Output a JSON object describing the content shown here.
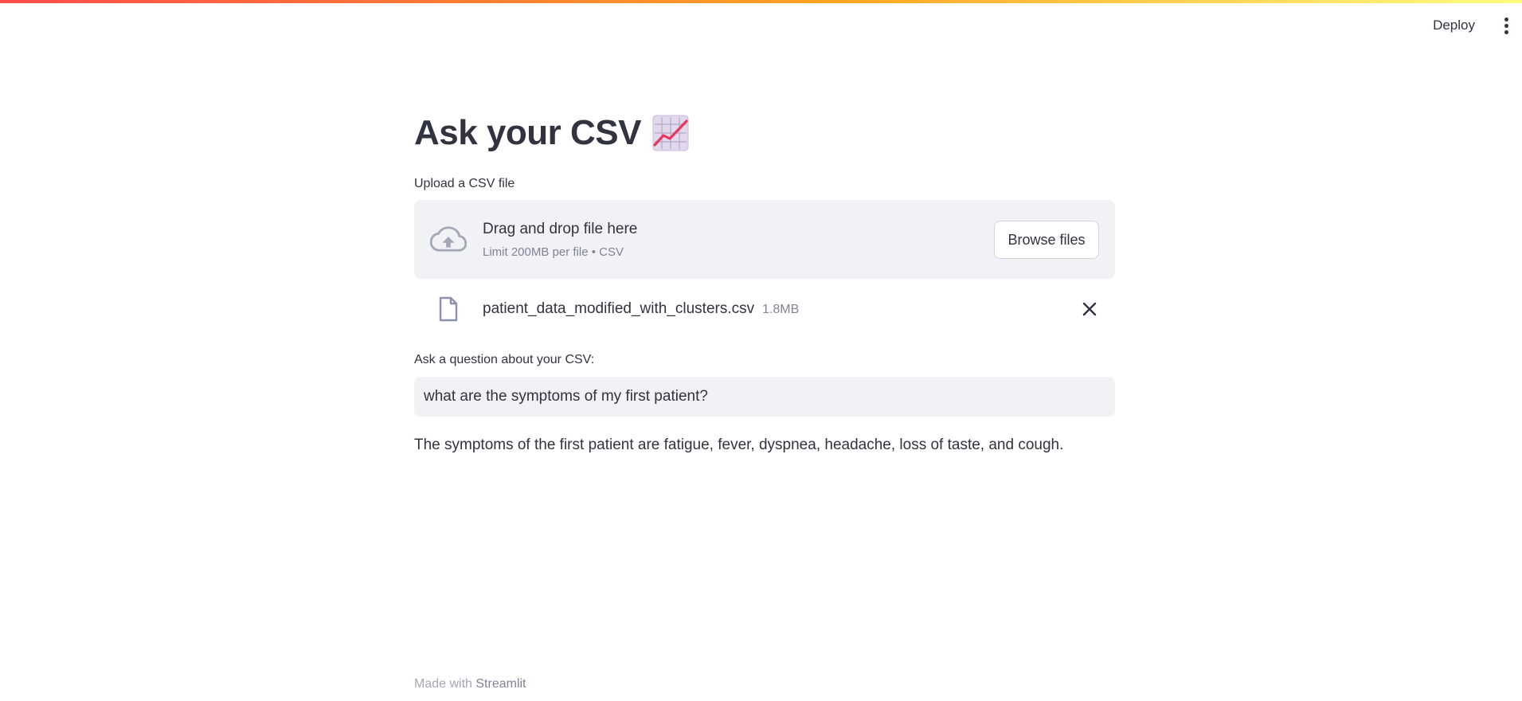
{
  "header": {
    "deploy_label": "Deploy",
    "menu_icon": "vertical-ellipsis-icon"
  },
  "main": {
    "title": "Ask your CSV",
    "title_emoji": "chart-increasing-icon"
  },
  "uploader": {
    "label": "Upload a CSV file",
    "dropzone_title": "Drag and drop file here",
    "dropzone_limits": "Limit 200MB per file • CSV",
    "browse_label": "Browse files",
    "icon": "cloud-upload-icon"
  },
  "uploaded_file": {
    "name": "patient_data_modified_with_clusters.csv",
    "size": "1.8MB",
    "icon": "file-icon",
    "remove_icon": "close-icon"
  },
  "question": {
    "label": "Ask a question about your CSV:",
    "value": "what are the symptoms of my first patient?"
  },
  "answer": {
    "text": "The symptoms of the first patient are fatigue, fever, dyspnea, headache, loss of taste, and cough."
  },
  "footer": {
    "prefix": "Made with",
    "link": "Streamlit"
  },
  "colors": {
    "accent": "#ff4b4b",
    "text": "#31333f",
    "muted": "#808495",
    "widget_bg": "#f0f2f6"
  }
}
